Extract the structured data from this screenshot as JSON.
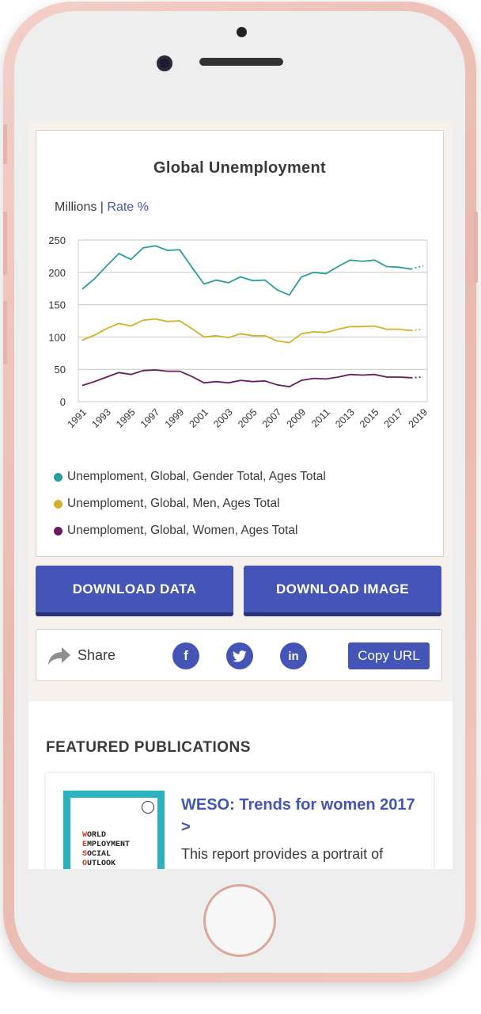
{
  "chart_data": {
    "type": "line",
    "title": "Global Unemployment",
    "units_label": "Millions",
    "separator": "|",
    "rate_label": "Rate %",
    "x": [
      "1991",
      "1992",
      "1993",
      "1994",
      "1995",
      "1996",
      "1997",
      "1998",
      "1999",
      "2000",
      "2001",
      "2002",
      "2003",
      "2004",
      "2005",
      "2006",
      "2007",
      "2008",
      "2009",
      "2010",
      "2011",
      "2012",
      "2013",
      "2014",
      "2015",
      "2016",
      "2017",
      "2018",
      "2019"
    ],
    "x_tick_labels": [
      "1991",
      "1993",
      "1995",
      "1997",
      "1999",
      "2001",
      "2003",
      "2005",
      "2007",
      "2009",
      "2011",
      "2013",
      "2015",
      "2017",
      "2019"
    ],
    "y_ticks": [
      "0",
      "50",
      "100",
      "150",
      "200",
      "250"
    ],
    "ylim": [
      0,
      250
    ],
    "projected_from": "2018",
    "series": [
      {
        "name": "Unemploment, Global, Gender Total, Ages Total",
        "color": "#2a9d9f",
        "values": [
          174,
          190,
          210,
          229,
          220,
          238,
          241,
          234,
          235,
          208,
          182,
          188,
          184,
          193,
          187,
          188,
          173,
          165,
          193,
          200,
          198,
          209,
          219,
          217,
          219,
          209,
          208,
          205,
          210
        ]
      },
      {
        "name": "Unemploment, Global, Men, Ages Total",
        "color": "#d3b12a",
        "values": [
          95,
          103,
          113,
          121,
          117,
          126,
          128,
          124,
          125,
          113,
          100,
          102,
          99,
          105,
          102,
          102,
          94,
          91,
          105,
          108,
          107,
          112,
          116,
          116,
          117,
          112,
          112,
          110,
          112
        ]
      },
      {
        "name": "Unemploment, Global, Women, Ages Total",
        "color": "#6b1a5e",
        "values": [
          25,
          31,
          38,
          45,
          42,
          48,
          49,
          47,
          47,
          39,
          29,
          31,
          29,
          33,
          31,
          32,
          26,
          23,
          33,
          36,
          35,
          38,
          42,
          41,
          42,
          38,
          38,
          37,
          38
        ]
      }
    ],
    "grid": true
  },
  "actions": {
    "download_data": "DOWNLOAD DATA",
    "download_image": "DOWNLOAD IMAGE"
  },
  "share": {
    "label": "Share",
    "facebook_icon": "f",
    "twitter_icon": "t",
    "linkedin_icon": "in",
    "copy_url": "Copy URL"
  },
  "featured": {
    "heading": "FEATURED PUBLICATIONS",
    "publication": {
      "title": "WESO: Trends for women 2017 >",
      "description": "This report provides a portrait of",
      "cover_lines": [
        {
          "initial": "W",
          "rest": "ORLD"
        },
        {
          "initial": "E",
          "rest": "MPLOYMENT"
        },
        {
          "initial": "S",
          "rest": "OCIAL"
        },
        {
          "initial": "O",
          "rest": "UTLOOK"
        }
      ]
    }
  },
  "colors": {
    "accent": "#4455b7",
    "accent_dark": "#29327a",
    "teal": "#2a9d9f",
    "gold": "#d3b12a",
    "purple": "#6b1a5e"
  }
}
